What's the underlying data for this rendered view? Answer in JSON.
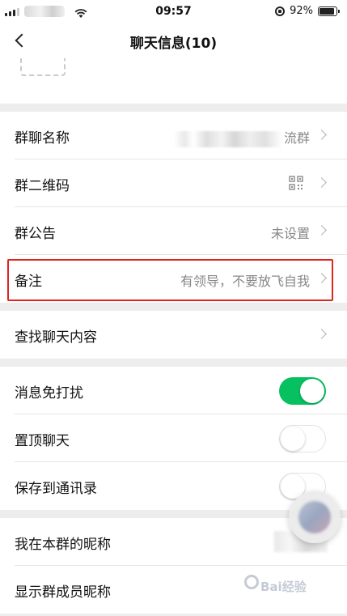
{
  "status_bar": {
    "time": "09:57",
    "battery_text": "92%",
    "battery_level": 0.92
  },
  "nav": {
    "title": "聊天信息(10)"
  },
  "settings_group_1": [
    {
      "label": "群聊名称",
      "value": "流群"
    },
    {
      "label": "群二维码",
      "icon": "qr-code-icon"
    },
    {
      "label": "群公告",
      "value": "未设置"
    },
    {
      "label": "备注",
      "value": "有领导，不要放飞自我"
    }
  ],
  "settings_group_2": [
    {
      "label": "查找聊天内容"
    }
  ],
  "settings_group_3": [
    {
      "label": "消息免打扰",
      "toggle_on": true
    },
    {
      "label": "置顶聊天",
      "toggle_on": false
    },
    {
      "label": "保存到通讯录",
      "toggle_on": false
    }
  ],
  "settings_group_4": [
    {
      "label": "我在本群的昵称"
    },
    {
      "label": "显示群成员昵称"
    }
  ],
  "colors": {
    "accent_green": "#07c160",
    "highlight_red": "#e0241f",
    "background": "#ededed"
  },
  "watermark_text": "Bai经验"
}
